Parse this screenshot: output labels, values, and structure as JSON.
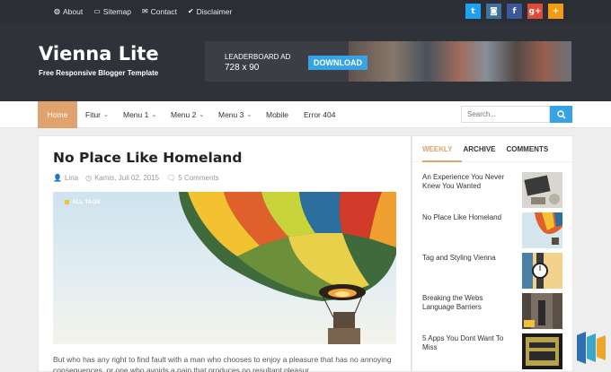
{
  "topbar": {
    "links": [
      {
        "label": "About",
        "icon": "globe-icon"
      },
      {
        "label": "Sitemap",
        "icon": "folder-icon"
      },
      {
        "label": "Contact",
        "icon": "envelope-icon"
      },
      {
        "label": "Disclaimer",
        "icon": "check-circle-icon"
      }
    ],
    "social": [
      {
        "icon": "twitter-icon",
        "glyph": "t",
        "color": "#1da1f2"
      },
      {
        "icon": "instagram-icon",
        "glyph": "◙",
        "color": "#3f729b"
      },
      {
        "icon": "facebook-icon",
        "glyph": "f",
        "color": "#3b5998"
      },
      {
        "icon": "google-plus-icon",
        "glyph": "g+",
        "color": "#dd4b39"
      },
      {
        "icon": "plus-icon",
        "glyph": "+",
        "color": "#f39c12"
      }
    ]
  },
  "header": {
    "title": "Vienna Lite",
    "tagline": "Free Responsive Blogger Template",
    "ad": {
      "line1": "LEADERBOARD AD",
      "line2": "728 x 90",
      "button": "DOWNLOAD"
    }
  },
  "nav": {
    "items": [
      {
        "label": "Home",
        "dropdown": false,
        "active": true
      },
      {
        "label": "Fitur",
        "dropdown": true
      },
      {
        "label": "Menu 1",
        "dropdown": true
      },
      {
        "label": "Menu 2",
        "dropdown": true
      },
      {
        "label": "Menu 3",
        "dropdown": true
      },
      {
        "label": "Mobile",
        "dropdown": false
      },
      {
        "label": "Error 404",
        "dropdown": false
      }
    ],
    "search_placeholder": "Search..."
  },
  "post": {
    "title": "No Place Like Homeland",
    "author": "Lina",
    "date": "Kamis, Juli 02, 2015",
    "comments": "5 Comments",
    "tag": "ALL TAGS",
    "excerpt": "But who has any right to find fault with a man who chooses to enjoy a pleasure that has no annoying consequences, or one who avoids a pain that produces no resultant pleasur..."
  },
  "sidebar": {
    "tabs": [
      "WEEKLY",
      "ARCHIVE",
      "COMMENTS"
    ],
    "items": [
      {
        "title": "An Experience You Never Knew You Wanted"
      },
      {
        "title": "No Place Like Homeland"
      },
      {
        "title": "Tag and Styling Vienna"
      },
      {
        "title": "Breaking the Webs Language Barriers"
      },
      {
        "title": "5 Apps You Dont Want To Miss"
      }
    ]
  },
  "colors": {
    "accent": "#e0a36d",
    "blue": "#36a3e4",
    "dark": "#2f3238"
  }
}
